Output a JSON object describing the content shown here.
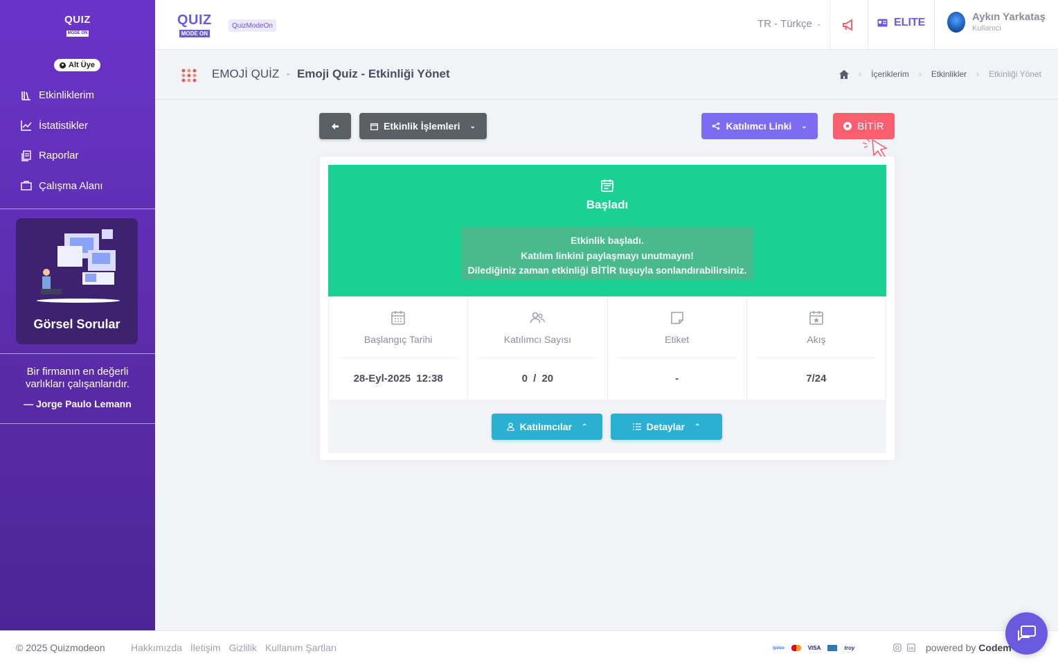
{
  "sidebar": {
    "logo_word": "QUIZ",
    "logo_sub": "MODE ON",
    "member_badge": "Alt Üye",
    "nav": [
      {
        "label": "Etkinliklerim",
        "icon": "library-icon"
      },
      {
        "label": "İstatistikler",
        "icon": "line-chart-icon"
      },
      {
        "label": "Raporlar",
        "icon": "copy-icon"
      },
      {
        "label": "Çalışma Alanı",
        "icon": "briefcase-icon"
      }
    ],
    "promo_title": "Görsel Sorular",
    "quote_text": "Bir firmanın en değerli varlıkları çalışanlarıdır.",
    "quote_author": "— Jorge Paulo Lemann"
  },
  "topbar": {
    "logo_word": "QUIZ",
    "logo_sub": "MODE ON",
    "brand_tag": "QuizModeOn",
    "language": "TR - Türkçe",
    "plan": "ELITE",
    "user_name": "Aykın Yarkataş",
    "user_role": "Kullanıcı"
  },
  "subheader": {
    "category": "EMOJİ QUİZ",
    "separator": "-",
    "title": "Emoji Quiz - Etkinliği Yönet",
    "breadcrumbs": [
      "İçeriklerim",
      "Etkinlikler",
      "Etkinliği Yönet"
    ]
  },
  "toolbar": {
    "actions_label": "Etkinlik İşlemleri",
    "participant_link_label": "Katılımcı Linki",
    "finish_label": "BİTİR"
  },
  "status": {
    "title": "Başladı",
    "message_lines": [
      "Etkinlik başladı.",
      "Katılım linkini paylaşmayı unutmayın!",
      "Dilediğiniz zaman etkinliği BİTİR tuşuyla sonlandırabilirsiniz."
    ]
  },
  "stats": [
    {
      "label": "Başlangıç Tarihi",
      "value": "28-Eyl-2025 12:38",
      "icon": "calendar-icon"
    },
    {
      "label": "Katılımcı Sayısı",
      "value": "0 / 20",
      "icon": "users-icon"
    },
    {
      "label": "Etiket",
      "value": "-",
      "icon": "sticky-note-icon"
    },
    {
      "label": "Akış",
      "value": "7/24",
      "icon": "calendar-star-icon"
    }
  ],
  "footer_buttons": {
    "participants_label": "Katılımcılar",
    "details_label": "Detaylar"
  },
  "footer": {
    "copyright": "© 2025 Quizmodeon",
    "links": [
      "Hakkımızda",
      "İletişim",
      "Gizlilik",
      "Kullanım Şartları"
    ],
    "payment_marks": [
      "iyzico",
      "mastercard",
      "VISA",
      "amex",
      "troy"
    ],
    "powered_by": "powered by ",
    "powered_by_brand": "Codem"
  },
  "colors": {
    "sidebar": "#6a34c9",
    "accent": "#6a5ae0",
    "status_green": "#18d192",
    "finish_red": "#fb5e6e",
    "action_cyan": "#2ab0d2"
  }
}
